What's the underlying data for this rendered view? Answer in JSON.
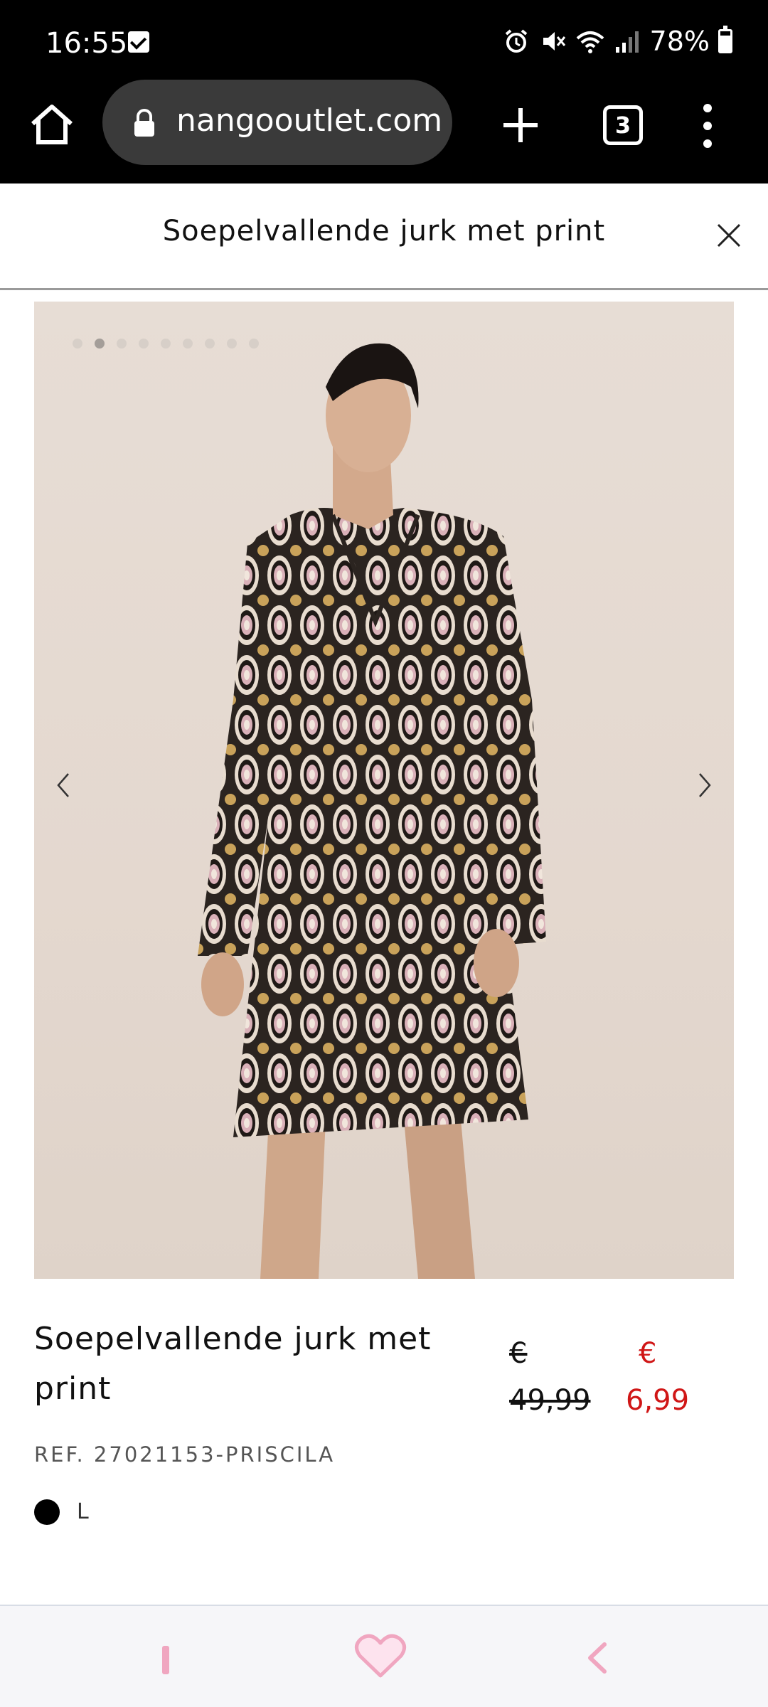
{
  "status_bar": {
    "time": "16:55",
    "battery": "78%",
    "battery_level": 0.78
  },
  "browser": {
    "url": "nangooutlet.com",
    "tab_count": "3"
  },
  "header": {
    "title": "Soepelvallende jurk met print"
  },
  "carousel": {
    "dot_count": 9,
    "active_index": 1
  },
  "product": {
    "name": "Soepelvallende jurk met print",
    "price_old_currency": "€",
    "price_old_amount": "49,99",
    "price_new_currency": "€",
    "price_new_amount": "6,99",
    "ref": "REF. 27021153-PRISCILA",
    "size": "L"
  },
  "colors": {
    "sale_red": "#d01616",
    "nav_pink": "#f0a6c0"
  },
  "icons": [
    "home-icon",
    "lock-icon",
    "plus-icon",
    "more-vert-icon",
    "close-icon",
    "chevron-left-icon",
    "chevron-right-icon",
    "heart-icon",
    "back-icon"
  ]
}
